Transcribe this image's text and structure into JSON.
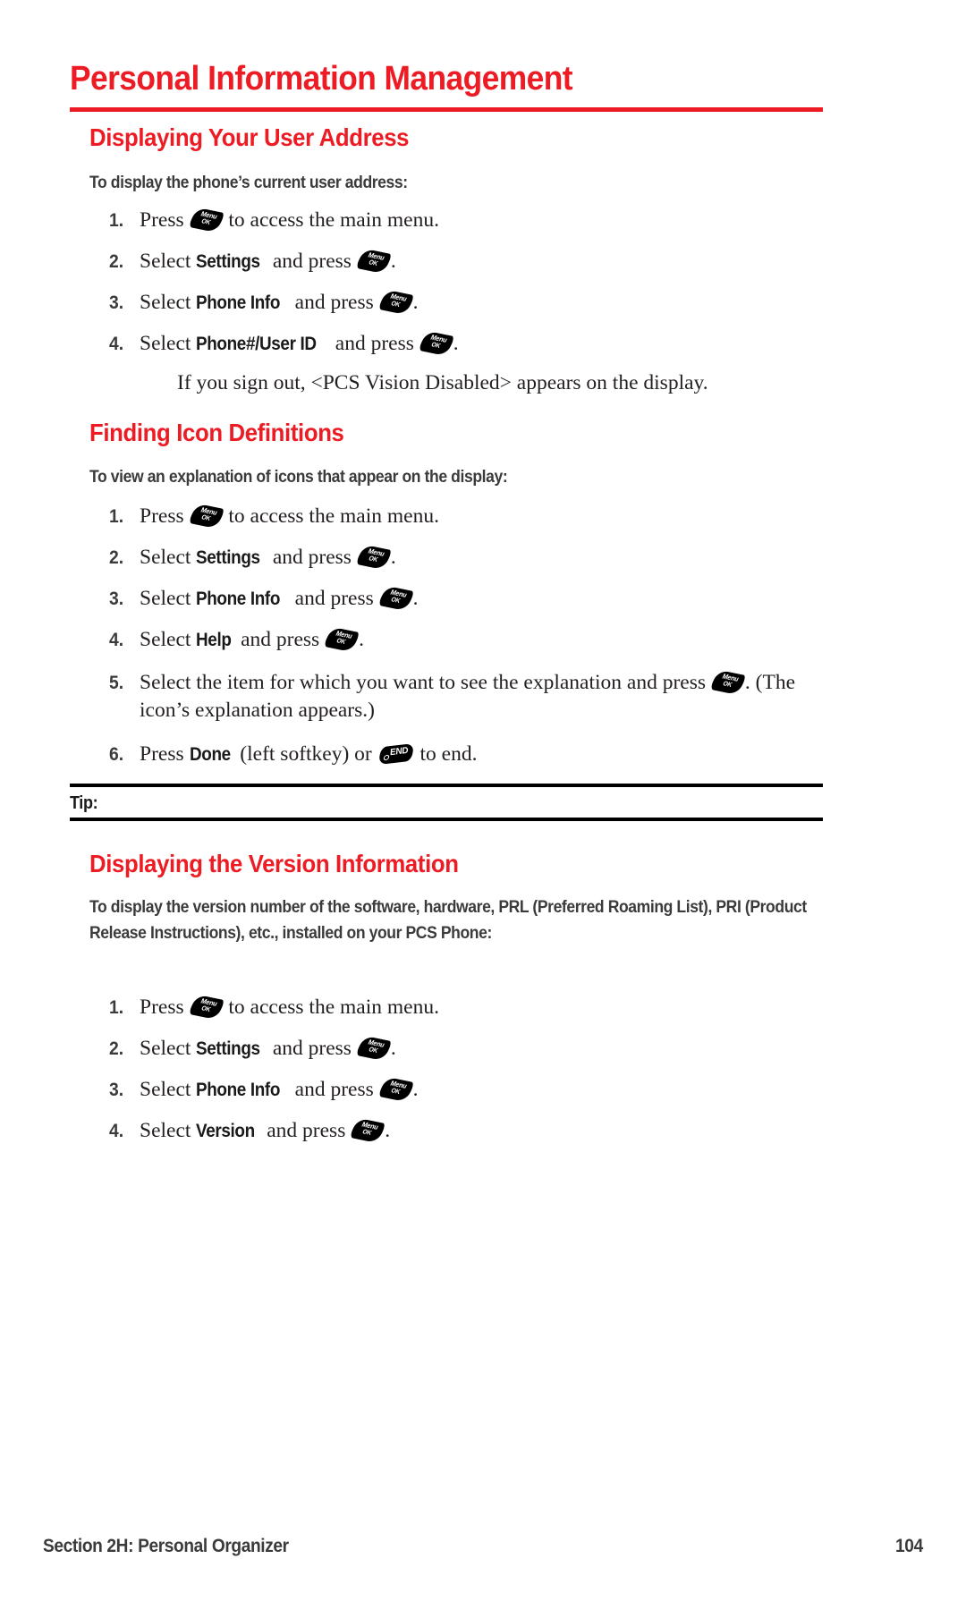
{
  "page": {
    "title": "Personal Information Management",
    "accent_color": "#ED1C24",
    "text_color": "#231f20",
    "number": "104",
    "footer_section": "Section 2H: Personal Organizer"
  },
  "sections": [
    {
      "heading": "Displaying Your User Address",
      "lead": "To display the phone’s current user address:",
      "steps": [
        {
          "num": "1.",
          "pre": "Press ",
          "bold": "",
          "post": " to access the main menu.",
          "key": "menu-ok-key"
        },
        {
          "num": "2.",
          "pre": "Select ",
          "bold": "Settings",
          "post": " and press ",
          "tail": ".",
          "key": "menu-ok-key"
        },
        {
          "num": "3.",
          "pre": "Select ",
          "bold": "Phone Info",
          "post": " and press ",
          "tail": ".",
          "key": "menu-ok-key"
        },
        {
          "num": "4.",
          "pre": "Select ",
          "bold": "Phone#/User ID",
          "post": " and press ",
          "tail": ".",
          "key": "menu-ok-key"
        }
      ],
      "note": "If you sign out, <PCS Vision Disabled> appears on the display."
    },
    {
      "heading": "Finding Icon Definitions",
      "lead": "To view an explanation of icons that appear on the display:",
      "steps": [
        {
          "num": "1.",
          "pre": "Press ",
          "bold": "",
          "post": " to access the main menu.",
          "key": "menu-ok-key"
        },
        {
          "num": "2.",
          "pre": "Select ",
          "bold": "Settings",
          "post": " and press ",
          "tail": ".",
          "key": "menu-ok-key"
        },
        {
          "num": "3.",
          "pre": "Select ",
          "bold": "Phone Info",
          "post": " and press ",
          "tail": ".",
          "key": "menu-ok-key"
        },
        {
          "num": "4.",
          "pre": "Select ",
          "bold": "Help",
          "post": " and press ",
          "tail": ".",
          "key": "menu-ok-key"
        },
        {
          "num": "5.",
          "pre": "Select the item for which you want to see the explanation and press ",
          "bold": "",
          "post": "",
          "tail": ". (The icon’s explanation appears.)",
          "key": "menu-ok-key"
        },
        {
          "num": "6.",
          "pre": "Press ",
          "bold": "Done",
          "post": " (left softkey) or ",
          "tail": " to end.",
          "key": "end-key"
        }
      ]
    },
    {
      "heading": "Displaying the Version Information",
      "lead": "To display the version number of the software, hardware, PRL (Preferred Roaming List), PRI (Product Release Instructions), etc., installed on your PCS Phone:",
      "steps": [
        {
          "num": "1.",
          "pre": "Press ",
          "bold": "",
          "post": " to access the main menu.",
          "key": "menu-ok-key"
        },
        {
          "num": "2.",
          "pre": "Select ",
          "bold": "Settings",
          "post": " and press ",
          "tail": ".",
          "key": "menu-ok-key"
        },
        {
          "num": "3.",
          "pre": "Select ",
          "bold": "Phone Info",
          "post": " and press ",
          "tail": ".",
          "key": "menu-ok-key"
        },
        {
          "num": "4.",
          "pre": "Select ",
          "bold": "Version",
          "post": " and press ",
          "tail": ".",
          "key": "menu-ok-key"
        }
      ]
    }
  ],
  "tip": {
    "label": "Tip:",
    "body": ""
  },
  "keys": {
    "menu_ok": {
      "line1": "Menu",
      "line2": "OK"
    },
    "end": {
      "label": "END"
    }
  }
}
